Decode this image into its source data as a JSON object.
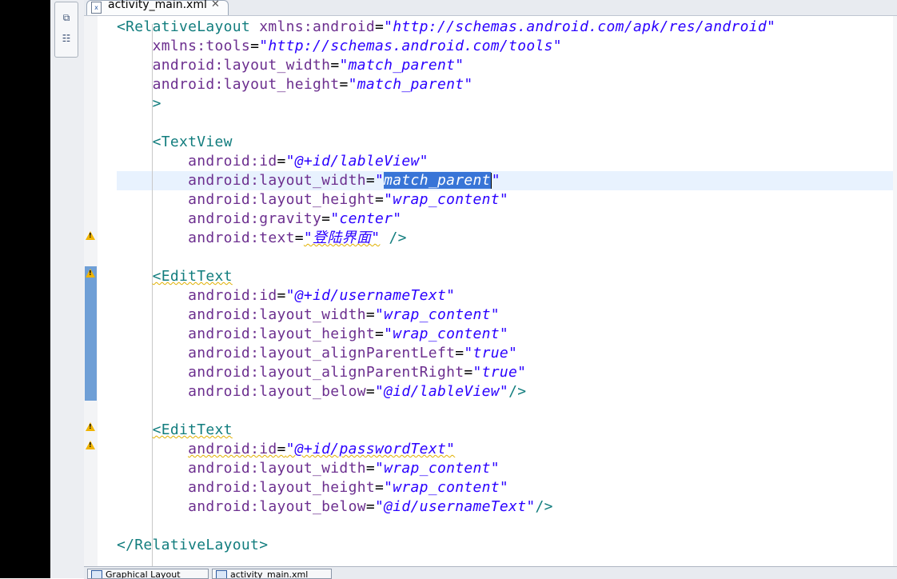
{
  "editor_tab": {
    "icon": "xml-file-icon",
    "label": "activity_main.xml",
    "close": "✕"
  },
  "side_tools": {
    "icons": [
      "restore-icon",
      "outline-icon"
    ]
  },
  "code_lines": [
    "<RelativeLayout xmlns:android=\"http://schemas.android.com/apk/res/android\"",
    "    xmlns:tools=\"http://schemas.android.com/tools\"",
    "    android:layout_width=\"match_parent\"",
    "    android:layout_height=\"match_parent\"",
    "    >",
    "",
    "    <TextView",
    "        android:id=\"@+id/lableView\"",
    "        android:layout_width=\"match_parent\"",
    "        android:layout_height=\"wrap_content\"",
    "        android:gravity=\"center\"",
    "        android:text=\"登陆界面\" />",
    "",
    "    <EditText",
    "        android:id=\"@+id/usernameText\"",
    "        android:layout_width=\"wrap_content\"",
    "        android:layout_height=\"wrap_content\"",
    "        android:layout_alignParentLeft=\"true\"",
    "        android:layout_alignParentRight=\"true\"",
    "        android:layout_below=\"@id/lableView\"/>",
    "",
    "    <EditText",
    "        android:id=\"@+id/passwordText\"",
    "        android:layout_width=\"wrap_content\"",
    "        android:layout_height=\"wrap_content\"",
    "        android:layout_below=\"@id/usernameText\"/>",
    "",
    "</RelativeLayout>"
  ],
  "selection": {
    "line": 9,
    "text": "match_parent"
  },
  "warning_icon": "warning-icon",
  "bottom_tabs": [
    {
      "icon": "graphical-layout-icon",
      "label": "Graphical Layout"
    },
    {
      "icon": "xml-source-icon",
      "label": "activity_main.xml"
    }
  ]
}
